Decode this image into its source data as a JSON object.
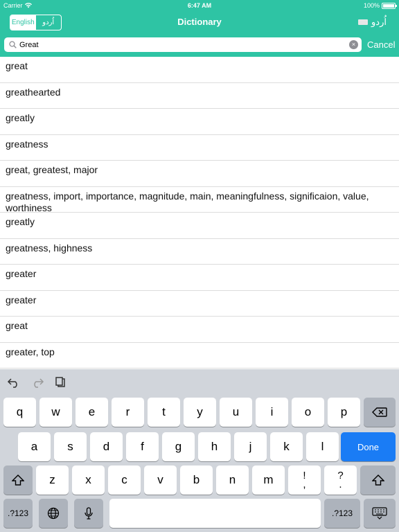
{
  "status_bar": {
    "carrier": "Carrier",
    "time": "6:47 AM",
    "battery": "100%"
  },
  "nav": {
    "lang_english": "English",
    "lang_urdu": "اُردو",
    "title": "Dictionary",
    "right_label": "اُردو"
  },
  "search": {
    "value": "Great",
    "cancel_label": "Cancel",
    "clear_symbol": "×"
  },
  "results": [
    "great",
    "greathearted",
    "greatly",
    "greatness",
    "great, greatest, major",
    "greatness, import, importance, magnitude, main, meaningfulness, significaion, value, worthiness",
    "greatly",
    "greatness, highness",
    "greater",
    "greater",
    "great",
    "greater, top"
  ],
  "keyboard": {
    "row1": [
      "q",
      "w",
      "e",
      "r",
      "t",
      "y",
      "u",
      "i",
      "o",
      "p"
    ],
    "row2": [
      "a",
      "s",
      "d",
      "f",
      "g",
      "h",
      "j",
      "k",
      "l"
    ],
    "row3": [
      "z",
      "x",
      "c",
      "v",
      "b",
      "n",
      "m"
    ],
    "excl_top": "!",
    "excl_bottom": ",",
    "quest_top": "?",
    "quest_bottom": ".",
    "done_label": "Done",
    "numbers_label": ".?123"
  }
}
